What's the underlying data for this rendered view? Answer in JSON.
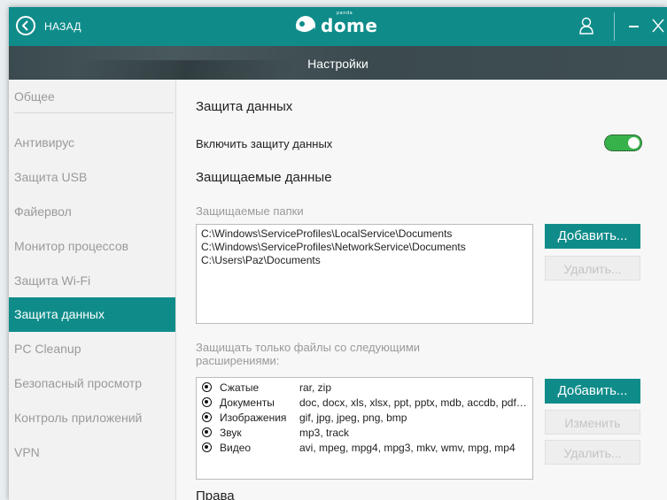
{
  "topbar": {
    "back_label": "НАЗАД",
    "logo_text": "dome",
    "logo_small": "panda"
  },
  "page": {
    "title": "Настройки"
  },
  "sidebar": {
    "items": [
      {
        "label": "Общее"
      },
      {
        "label": "Антивирус"
      },
      {
        "label": "Защита USB"
      },
      {
        "label": "Файервол"
      },
      {
        "label": "Монитор процессов"
      },
      {
        "label": "Защита Wi-Fi"
      },
      {
        "label": "Защита данных"
      },
      {
        "label": "PC Cleanup"
      },
      {
        "label": "Безопасный просмотр"
      },
      {
        "label": "Контроль приложений"
      },
      {
        "label": "VPN"
      }
    ],
    "active": "Защита данных"
  },
  "main": {
    "heading": "Защита данных",
    "enable_label": "Включить защиту данных",
    "enable_on": true,
    "protected_heading": "Защищаемые данные",
    "folders_label": "Защищаемые папки",
    "folders": [
      "C:\\Windows\\ServiceProfiles\\LocalService\\Documents",
      "C:\\Windows\\ServiceProfiles\\NetworkService\\Documents",
      "C:\\Users\\Paz\\Documents"
    ],
    "folders_add": "Добавить...",
    "folders_delete": "Удалить...",
    "ext_label": "Защищать только файлы со следующими расширениями:",
    "extensions": [
      {
        "category": "Сжатые",
        "values": "rar, zip"
      },
      {
        "category": "Документы",
        "values": "doc, docx, xls, xlsx, ppt, pptx, mdb, accdb, pdf,..."
      },
      {
        "category": "Изображения",
        "values": "gif, jpg, jpeg, png, bmp"
      },
      {
        "category": "Звук",
        "values": "mp3, track"
      },
      {
        "category": "Видео",
        "values": "avi, mpeg, mpg4, mpg3, mkv, wmv, mpg, mp4"
      }
    ],
    "ext_add": "Добавить...",
    "ext_edit": "Изменить",
    "ext_delete": "Удалить...",
    "rights_heading": "Права"
  },
  "colors": {
    "accent": "#0f8c8a",
    "toggle_on": "#37b14a"
  }
}
